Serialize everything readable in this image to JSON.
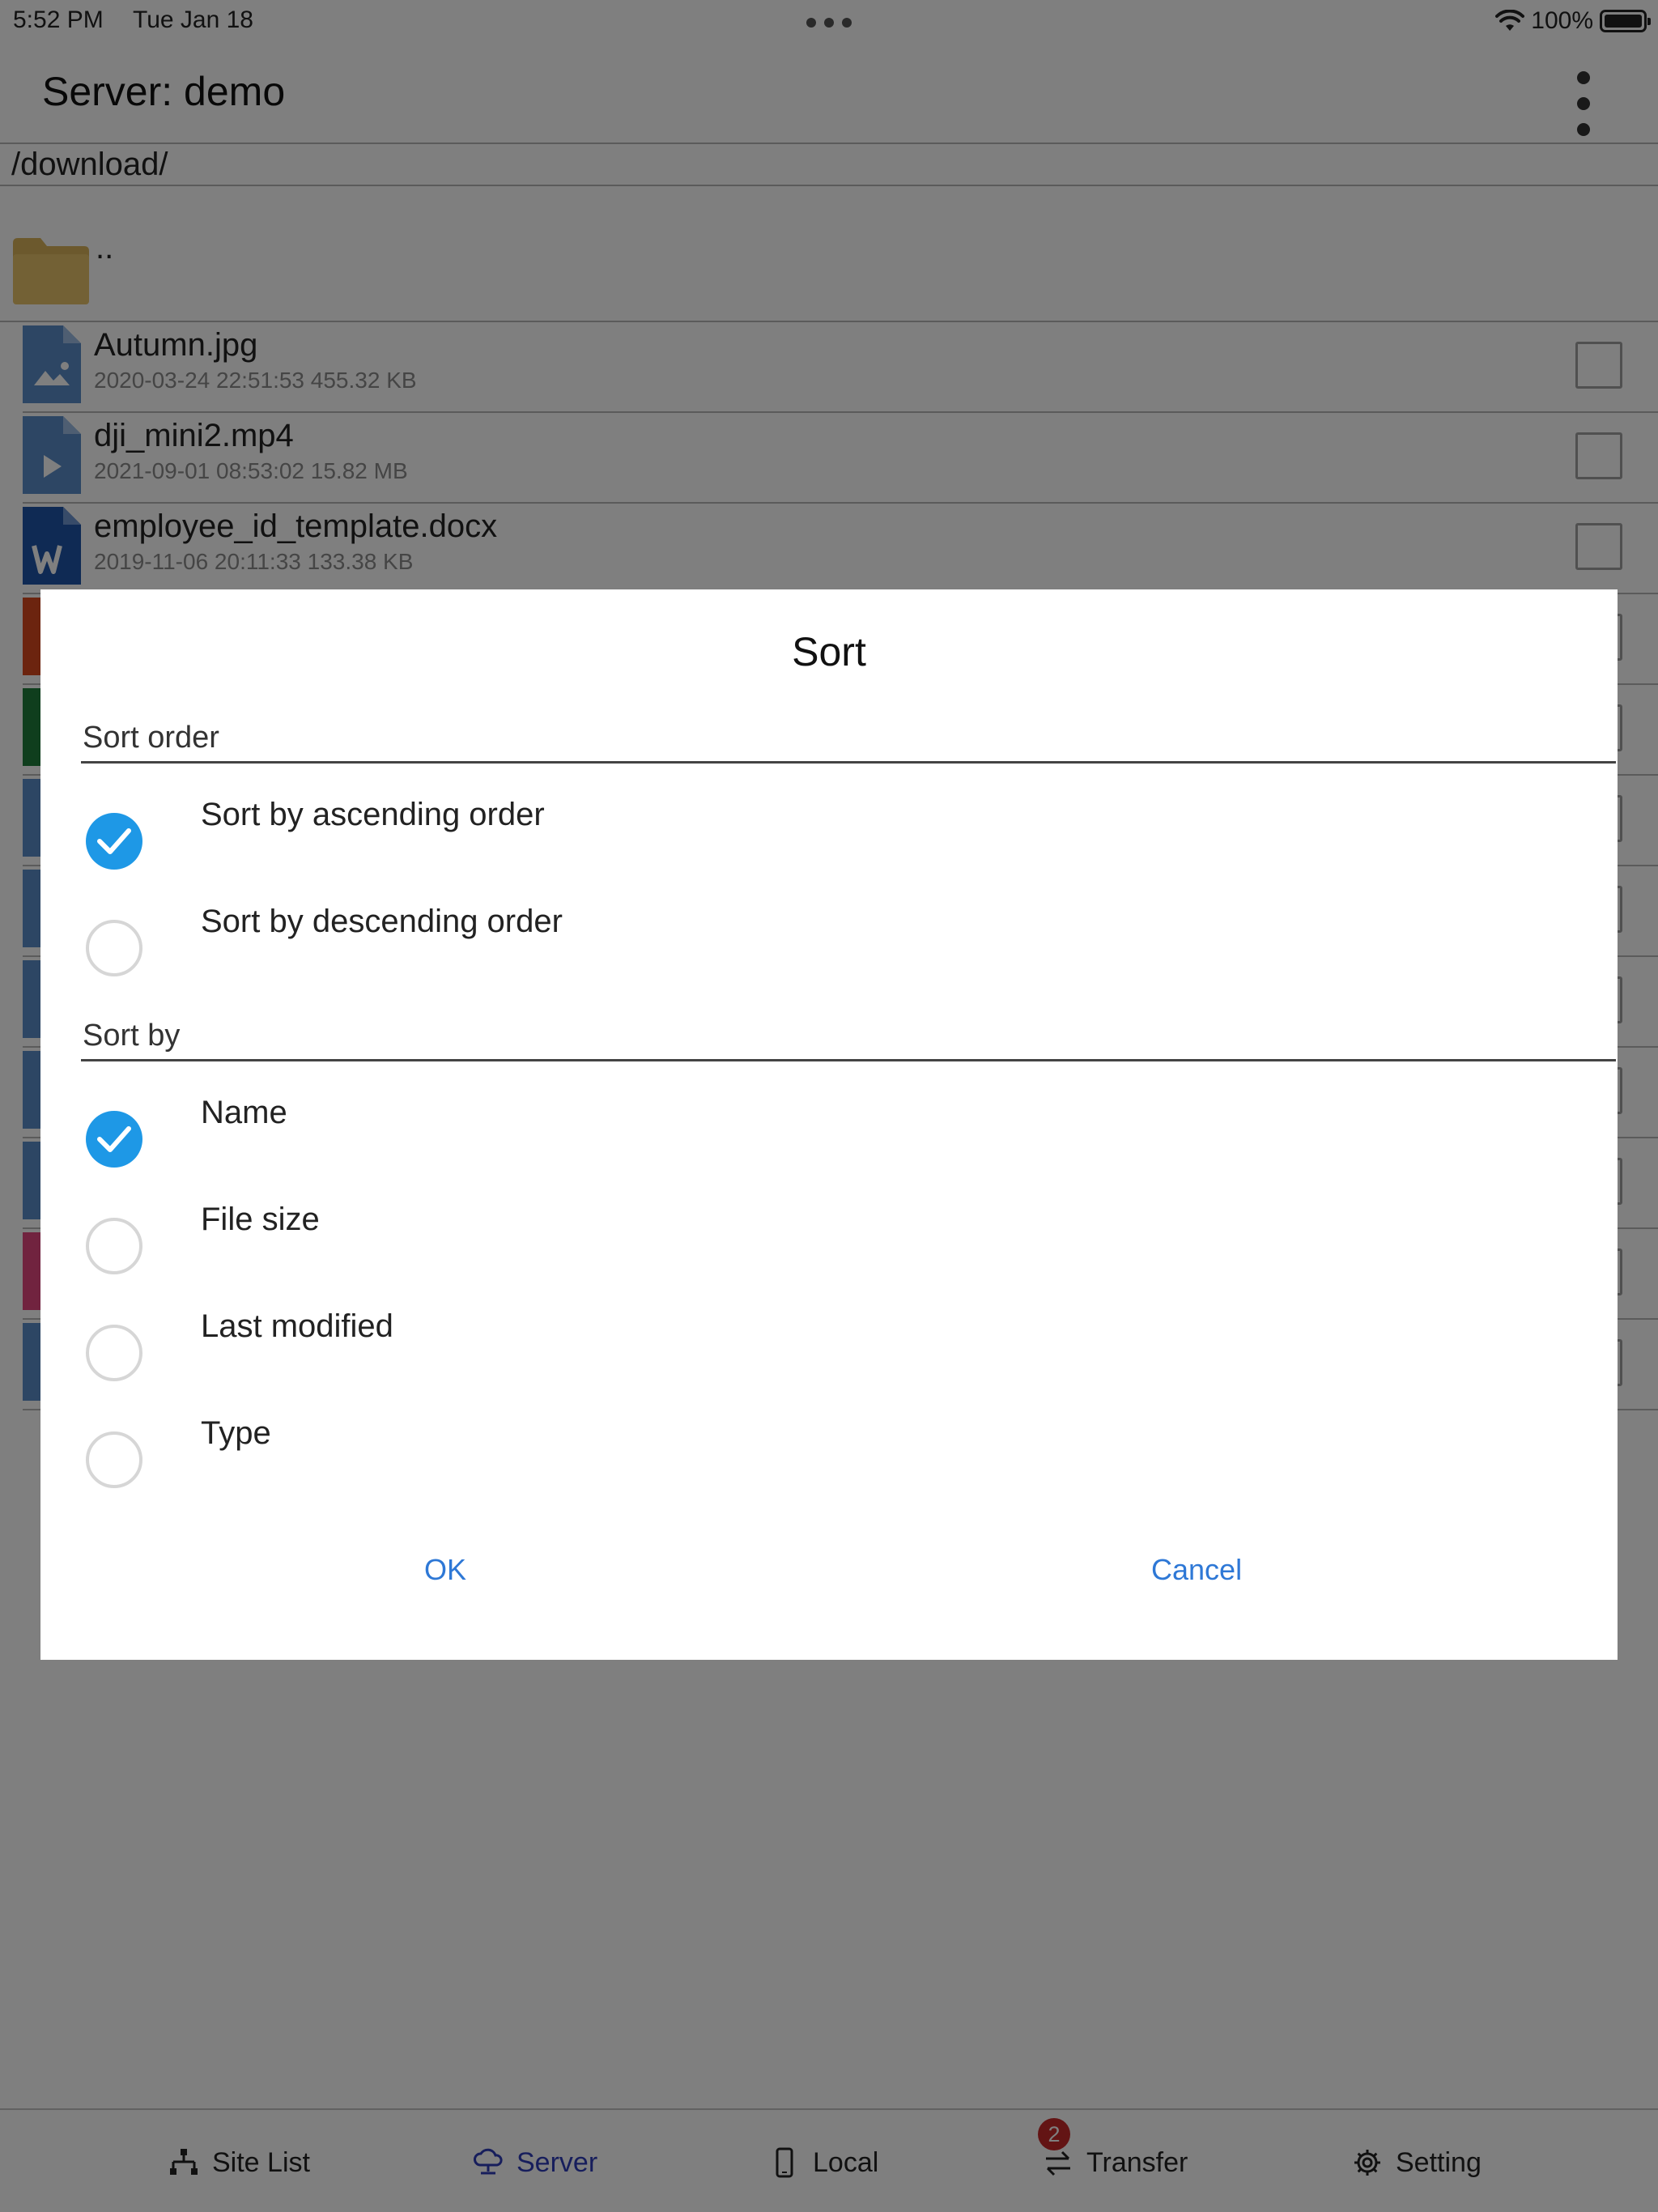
{
  "status_bar": {
    "time": "5:52 PM",
    "date": "Tue Jan 18",
    "battery": "100%"
  },
  "header": {
    "title": "Server:  demo",
    "menu_icon": "more-vertical-icon"
  },
  "path": "/download/",
  "file_list": {
    "parent_label": "..",
    "files": [
      {
        "name": "Autumn.jpg",
        "meta": "2020-03-24 22:51:53  455.32 KB",
        "icon": "image-file-icon",
        "color": "#5b8dc9"
      },
      {
        "name": "dji_mini2.mp4",
        "meta": "2021-09-01 08:53:02  15.82 MB",
        "icon": "video-file-icon",
        "color": "#5b8dc9"
      },
      {
        "name": "employee_id_template.docx",
        "meta": "2019-11-06 20:11:33  133.38 KB",
        "icon": "word-file-icon",
        "color": "#1f55a8"
      }
    ]
  },
  "dialog": {
    "title": "Sort",
    "sort_order": {
      "label": "Sort order",
      "options": [
        {
          "label": "Sort by ascending order",
          "checked": true
        },
        {
          "label": "Sort by descending order",
          "checked": false
        }
      ]
    },
    "sort_by": {
      "label": "Sort by",
      "options": [
        {
          "label": "Name",
          "checked": true
        },
        {
          "label": "File size",
          "checked": false
        },
        {
          "label": "Last modified",
          "checked": false
        },
        {
          "label": "Type",
          "checked": false
        }
      ]
    },
    "ok_label": "OK",
    "cancel_label": "Cancel"
  },
  "tab_bar": {
    "tabs": [
      {
        "label": "Site List",
        "icon": "sitemap-icon",
        "active": false
      },
      {
        "label": "Server",
        "icon": "cloud-server-icon",
        "active": true
      },
      {
        "label": "Local",
        "icon": "phone-icon",
        "active": false
      },
      {
        "label": "Transfer",
        "icon": "transfer-arrows-icon",
        "active": false,
        "badge": "2"
      },
      {
        "label": "Setting",
        "icon": "gear-icon",
        "active": false
      }
    ]
  },
  "colors": {
    "accent": "#1e98e6",
    "link": "#2e78d6",
    "active_tab": "#2e3db8",
    "badge": "#c62828"
  }
}
